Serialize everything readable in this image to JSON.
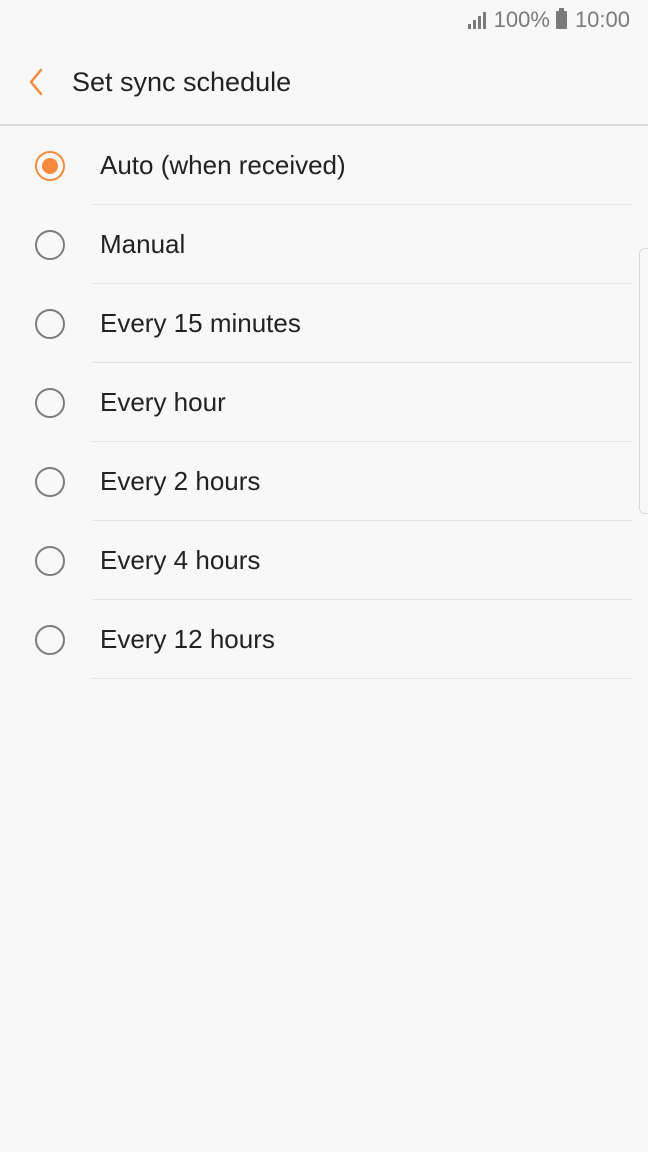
{
  "status_bar": {
    "battery_text": "100%",
    "time": "10:00"
  },
  "app_bar": {
    "title": "Set sync schedule"
  },
  "accent_color": "#f48b3c",
  "options": [
    {
      "label": "Auto (when received)",
      "selected": true
    },
    {
      "label": "Manual",
      "selected": false
    },
    {
      "label": "Every 15 minutes",
      "selected": false
    },
    {
      "label": "Every hour",
      "selected": false
    },
    {
      "label": "Every 2 hours",
      "selected": false
    },
    {
      "label": "Every 4 hours",
      "selected": false
    },
    {
      "label": "Every 12 hours",
      "selected": false
    }
  ]
}
